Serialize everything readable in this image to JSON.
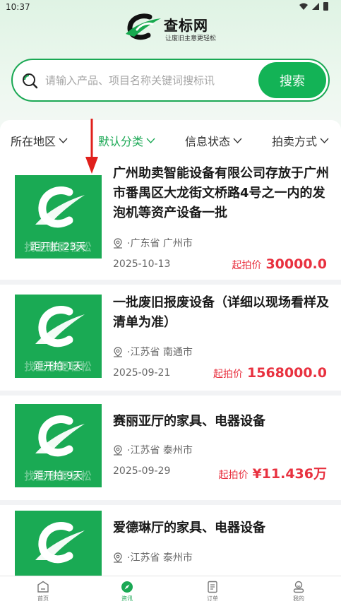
{
  "status_bar": {
    "time": "10:37"
  },
  "brand": {
    "name": "查标网",
    "slogan": "让废旧主意更轻松"
  },
  "search": {
    "placeholder": "请输入产品、项目名称关键词搜标讯",
    "button_label": "搜索"
  },
  "filters": [
    {
      "label": "所在地区",
      "active": false
    },
    {
      "label": "默认分类",
      "active": true
    },
    {
      "label": "信息状态",
      "active": false
    },
    {
      "label": "拍卖方式",
      "active": false
    }
  ],
  "thumb_slogan": "找主意更轻松",
  "price_label": "起拍价",
  "items": [
    {
      "title": "广州助卖智能设备有限公司存放于广州市番禺区大龙街文桥路4号之一内的发泡机等资产设备一批",
      "location": "·广东省 广州市",
      "date": "2025-10-13",
      "price": "30000.0",
      "countdown": "距开拍:23天"
    },
    {
      "title": "一批废旧报废设备（详细以现场看样及清单为准）",
      "location": "·江苏省 南通市",
      "date": "2025-09-21",
      "price": "1568000.0",
      "countdown": "距开拍:1天"
    },
    {
      "title": "赛丽亚厅的家具、电器设备",
      "location": "·江苏省 泰州市",
      "date": "2025-09-29",
      "price": "¥11.436万",
      "countdown": "距开拍:9天"
    },
    {
      "title": "爱德琳厅的家具、电器设备",
      "location": "·江苏省 泰州市",
      "date": "",
      "price": "",
      "countdown": ""
    }
  ],
  "tabbar": [
    {
      "label": "首页",
      "icon": "home-icon",
      "active": false
    },
    {
      "label": "资讯",
      "icon": "compass-icon",
      "active": true
    },
    {
      "label": "订单",
      "icon": "order-icon",
      "active": false
    },
    {
      "label": "我的",
      "icon": "profile-icon",
      "active": false
    }
  ],
  "colors": {
    "accent": "#13b356",
    "price": "#e8313f",
    "annotation_arrow": "#e0201c"
  }
}
